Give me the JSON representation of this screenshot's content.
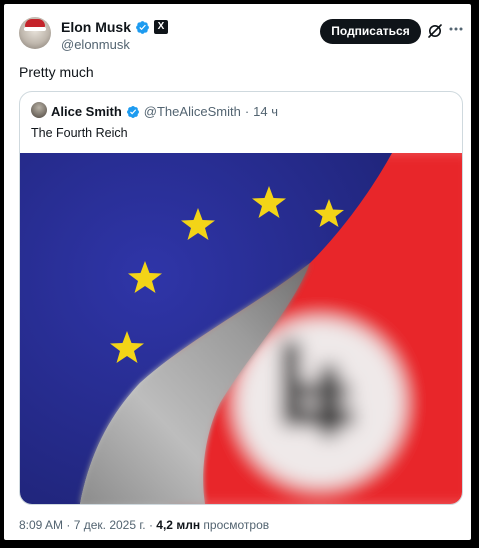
{
  "post": {
    "author_name": "Elon Musk",
    "author_handle": "@elonmusk",
    "affiliation_badge": "X",
    "subscribe_label": "Подписаться",
    "text": "Pretty much",
    "icons": [
      "verified-icon",
      "x-affiliate-icon",
      "grok-icon",
      "more-icon"
    ]
  },
  "quote": {
    "author_name": "Alice Smith",
    "author_handle": "@TheAliceSmith",
    "separator": "·",
    "time": "14 ч",
    "text": "The Fourth Reich"
  },
  "footer": {
    "time": "8:09 AM",
    "separator1": "·",
    "date": "7 дек. 2025 г.",
    "separator2": "·",
    "views_count": "4,2 млн",
    "views_label": "просмотров"
  },
  "colors": {
    "text_primary": "#0f1419",
    "text_secondary": "#536471",
    "verified_blue": "#1d9bf0",
    "eu_blue": "#2a2f9a",
    "eu_star_gold": "#f3d417",
    "flag_red": "#e8252b"
  }
}
